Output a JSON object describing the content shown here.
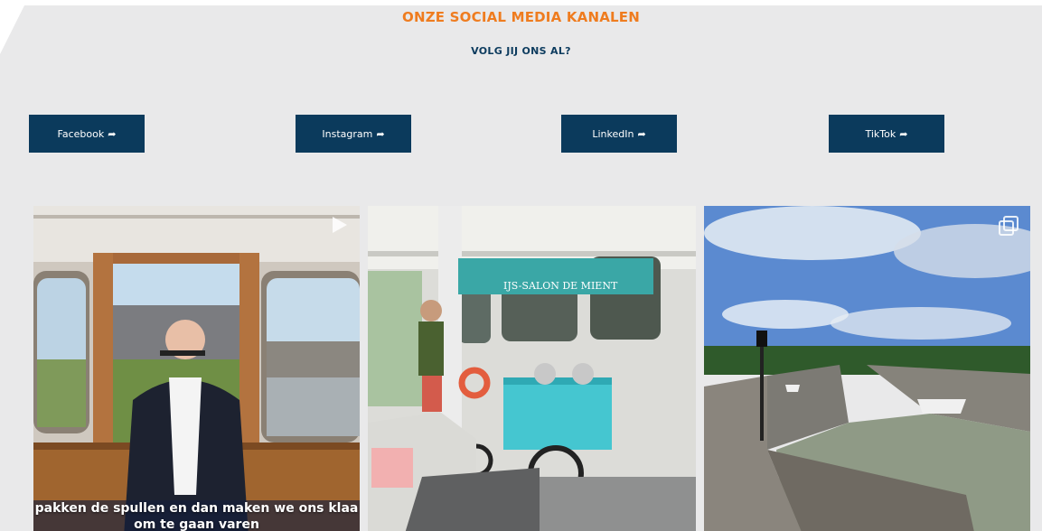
{
  "section": {
    "heading": "ONZE SOCIAL MEDIA KANALEN",
    "subheading": "VOLG JIJ ONS AL?"
  },
  "social_buttons": [
    {
      "label": "Facebook",
      "icon": "share-arrow-icon"
    },
    {
      "label": "Instagram",
      "icon": "share-arrow-icon"
    },
    {
      "label": "LinkedIn",
      "icon": "share-arrow-icon"
    },
    {
      "label": "TikTok",
      "icon": "share-arrow-icon"
    }
  ],
  "feed": [
    {
      "type": "video",
      "badge_icon": "play-icon",
      "caption_line1": "pakken de spullen en dan maken we ons klaa",
      "caption_line2": "om te gaan varen"
    },
    {
      "type": "image",
      "sign_text": "IJS-SALON DE MIENT"
    },
    {
      "type": "album",
      "badge_icon": "multiple-images-icon"
    }
  ],
  "colors": {
    "accent": "#ef7c1f",
    "brand": "#0b3a5c",
    "panel": "#e9e9ea"
  }
}
